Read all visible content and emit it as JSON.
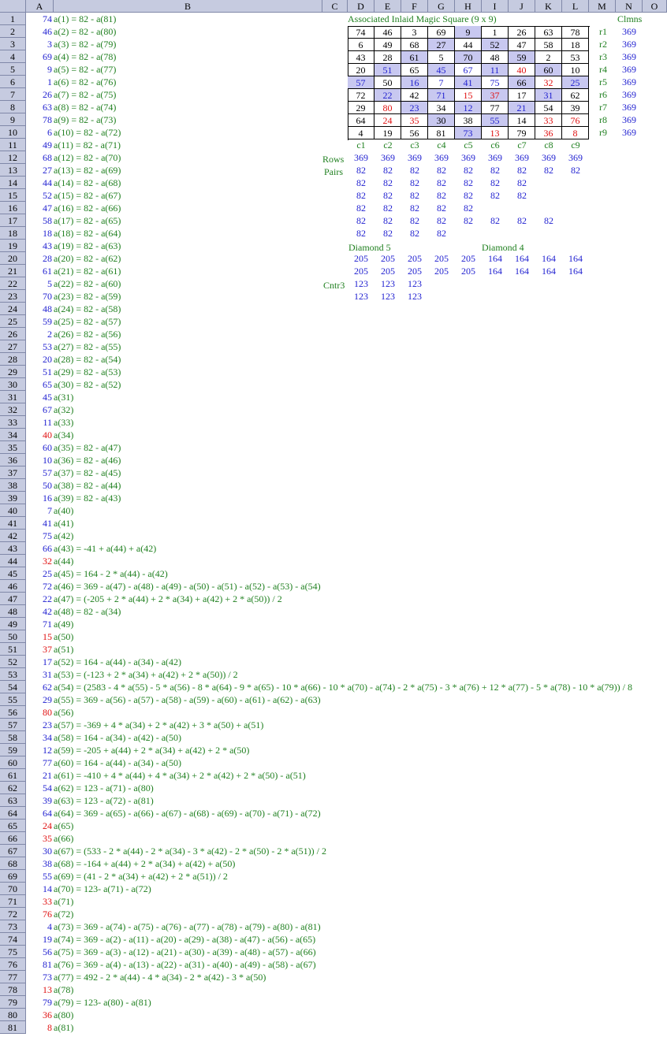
{
  "columns": [
    "A",
    "B",
    "C",
    "D",
    "E",
    "F",
    "G",
    "H",
    "I",
    "J",
    "K",
    "L",
    "M",
    "N",
    "O"
  ],
  "rows_count": 81,
  "colors": {
    "blue": "#1f1fd0",
    "red": "#e01010",
    "green": "#208020",
    "header": "#c6cbe0",
    "highlight": "#c8c8f0"
  },
  "colA": [
    {
      "v": "74",
      "c": "blue"
    },
    {
      "v": "46",
      "c": "blue"
    },
    {
      "v": "3",
      "c": "blue"
    },
    {
      "v": "69",
      "c": "blue"
    },
    {
      "v": "9",
      "c": "blue"
    },
    {
      "v": "1",
      "c": "blue"
    },
    {
      "v": "26",
      "c": "blue"
    },
    {
      "v": "63",
      "c": "blue"
    },
    {
      "v": "78",
      "c": "blue"
    },
    {
      "v": "6",
      "c": "blue"
    },
    {
      "v": "49",
      "c": "blue"
    },
    {
      "v": "68",
      "c": "blue"
    },
    {
      "v": "27",
      "c": "blue"
    },
    {
      "v": "44",
      "c": "blue"
    },
    {
      "v": "52",
      "c": "blue"
    },
    {
      "v": "47",
      "c": "blue"
    },
    {
      "v": "58",
      "c": "blue"
    },
    {
      "v": "18",
      "c": "blue"
    },
    {
      "v": "43",
      "c": "blue"
    },
    {
      "v": "28",
      "c": "blue"
    },
    {
      "v": "61",
      "c": "blue"
    },
    {
      "v": "5",
      "c": "blue"
    },
    {
      "v": "70",
      "c": "blue"
    },
    {
      "v": "48",
      "c": "blue"
    },
    {
      "v": "59",
      "c": "blue"
    },
    {
      "v": "2",
      "c": "blue"
    },
    {
      "v": "53",
      "c": "blue"
    },
    {
      "v": "20",
      "c": "blue"
    },
    {
      "v": "51",
      "c": "blue"
    },
    {
      "v": "65",
      "c": "blue"
    },
    {
      "v": "45",
      "c": "blue"
    },
    {
      "v": "67",
      "c": "blue"
    },
    {
      "v": "11",
      "c": "blue"
    },
    {
      "v": "40",
      "c": "red"
    },
    {
      "v": "60",
      "c": "blue"
    },
    {
      "v": "10",
      "c": "blue"
    },
    {
      "v": "57",
      "c": "blue"
    },
    {
      "v": "50",
      "c": "blue"
    },
    {
      "v": "16",
      "c": "blue"
    },
    {
      "v": "7",
      "c": "blue"
    },
    {
      "v": "41",
      "c": "blue"
    },
    {
      "v": "75",
      "c": "blue"
    },
    {
      "v": "66",
      "c": "blue"
    },
    {
      "v": "32",
      "c": "red"
    },
    {
      "v": "25",
      "c": "blue"
    },
    {
      "v": "72",
      "c": "blue"
    },
    {
      "v": "22",
      "c": "blue"
    },
    {
      "v": "42",
      "c": "blue"
    },
    {
      "v": "71",
      "c": "blue"
    },
    {
      "v": "15",
      "c": "red"
    },
    {
      "v": "37",
      "c": "red"
    },
    {
      "v": "17",
      "c": "blue"
    },
    {
      "v": "31",
      "c": "blue"
    },
    {
      "v": "62",
      "c": "blue"
    },
    {
      "v": "29",
      "c": "blue"
    },
    {
      "v": "80",
      "c": "red"
    },
    {
      "v": "23",
      "c": "blue"
    },
    {
      "v": "34",
      "c": "blue"
    },
    {
      "v": "12",
      "c": "blue"
    },
    {
      "v": "77",
      "c": "blue"
    },
    {
      "v": "21",
      "c": "blue"
    },
    {
      "v": "54",
      "c": "blue"
    },
    {
      "v": "39",
      "c": "blue"
    },
    {
      "v": "64",
      "c": "blue"
    },
    {
      "v": "24",
      "c": "red"
    },
    {
      "v": "35",
      "c": "red"
    },
    {
      "v": "30",
      "c": "blue"
    },
    {
      "v": "38",
      "c": "blue"
    },
    {
      "v": "55",
      "c": "blue"
    },
    {
      "v": "14",
      "c": "blue"
    },
    {
      "v": "33",
      "c": "red"
    },
    {
      "v": "76",
      "c": "red"
    },
    {
      "v": "4",
      "c": "blue"
    },
    {
      "v": "19",
      "c": "blue"
    },
    {
      "v": "56",
      "c": "blue"
    },
    {
      "v": "81",
      "c": "blue"
    },
    {
      "v": "73",
      "c": "blue"
    },
    {
      "v": "13",
      "c": "red"
    },
    {
      "v": "79",
      "c": "blue"
    },
    {
      "v": "36",
      "c": "red"
    },
    {
      "v": "8",
      "c": "red"
    }
  ],
  "colB": [
    "a(1) = 82 - a(81)",
    "a(2) = 82 - a(80)",
    "a(3) = 82 - a(79)",
    "a(4) = 82 - a(78)",
    "a(5) = 82 - a(77)",
    "a(6) = 82 - a(76)",
    "a(7) = 82 - a(75)",
    "a(8) = 82 - a(74)",
    "a(9) = 82 - a(73)",
    "a(10) = 82 - a(72)",
    "a(11) = 82 - a(71)",
    "a(12) = 82 - a(70)",
    "a(13) = 82 - a(69)",
    "a(14) = 82 - a(68)",
    "a(15) = 82 - a(67)",
    "a(16) = 82 - a(66)",
    "a(17) = 82 - a(65)",
    "a(18) = 82 - a(64)",
    "a(19) = 82 - a(63)",
    "a(20) = 82 - a(62)",
    "a(21) = 82 - a(61)",
    "a(22) = 82 - a(60)",
    "a(23) = 82 - a(59)",
    "a(24) = 82 - a(58)",
    "a(25) = 82 - a(57)",
    "a(26) = 82 - a(56)",
    "a(27) = 82 - a(55)",
    "a(28) = 82 - a(54)",
    "a(29) = 82 - a(53)",
    "a(30) = 82 - a(52)",
    "a(31)",
    "a(32)",
    "a(33)",
    "a(34)",
    "a(35) = 82 - a(47)",
    "a(36) = 82 - a(46)",
    "a(37) = 82 - a(45)",
    "a(38) = 82 - a(44)",
    "a(39) = 82 - a(43)",
    "a(40)",
    "a(41)",
    "a(42)",
    "a(43) = -41 + a(44) + a(42)",
    "a(44)",
    "a(45) = 164 - 2 * a(44) - a(42)",
    "a(46) = 369 - a(47) - a(48) - a(49) - a(50) - a(51) - a(52) - a(53) - a(54)",
    "a(47) = (-205 + 2 * a(44) + 2 * a(34) + a(42) + 2 * a(50)) / 2",
    "a(48) = 82 - a(34)",
    "a(49)",
    "a(50)",
    "a(51)",
    "a(52) = 164 - a(44) - a(34) - a(42)",
    "a(53) = (-123 + 2 * a(34) + a(42) + 2 * a(50)) / 2",
    "a(54) = (2583 - 4 * a(55) - 5 * a(56) - 8 * a(64) - 9 * a(65) - 10 * a(66) - 10 * a(70) - a(74) - 2 * a(75) - 3 * a(76) + 12 * a(77) - 5 * a(78) - 10 * a(79)) / 8",
    "a(55) = 369 - a(56) - a(57) - a(58) - a(59) - a(60) - a(61) - a(62) - a(63)",
    "a(56)",
    "a(57) = -369 + 4 * a(34) + 2 * a(42) + 3 * a(50) + a(51)",
    "a(58) = 164 - a(34) - a(42) - a(50)",
    "a(59) = -205 + a(44) + 2 * a(34) + a(42) + 2 * a(50)",
    "a(60) = 164 - a(44) - a(34) - a(50)",
    "a(61) = -410 + 4 * a(44) + 4 * a(34) + 2 * a(42) + 2 * a(50) - a(51)",
    "a(62) = 123 - a(71) - a(80)",
    "a(63) = 123 - a(72) - a(81)",
    "a(64) = 369 - a(65) - a(66) - a(67) - a(68) - a(69) - a(70) - a(71) - a(72)",
    "a(65)",
    "a(66)",
    "a(67) = (533 - 2 * a(44) - 2 * a(34) - 3 * a(42) - 2 * a(50) - 2 * a(51)) / 2",
    "a(68) = -164 + a(44) + 2 * a(34) + a(42) + a(50)",
    "a(69) = (41 - 2 * a(34) + a(42) + 2 * a(51)) / 2",
    "a(70) = 123- a(71) - a(72)",
    "a(71)",
    "a(72)",
    "a(73) = 369 - a(74) - a(75) - a(76) - a(77) - a(78) - a(79) - a(80) - a(81)",
    "a(74) = 369 - a(2) - a(11) - a(20) - a(29) - a(38) - a(47) - a(56) - a(65)",
    "a(75) = 369 - a(3) - a(12) - a(21) - a(30) - a(39) - a(48) - a(57) - a(66)",
    "a(76) = 369 - a(4) - a(13) - a(22) - a(31) - a(40) - a(49) - a(58) - a(67)",
    "a(77) = 492 - 2 * a(44) - 4 * a(34) - 2 * a(42) - 3 * a(50)",
    "a(78)",
    "a(79) = 123- a(80) - a(81)",
    "a(80)",
    "a(81)"
  ],
  "square_title": "Associated Inlaid Magic Square (9 x 9)",
  "square": [
    [
      "74",
      "46",
      "3",
      "69",
      "9",
      "1",
      "26",
      "63",
      "78"
    ],
    [
      "6",
      "49",
      "68",
      "27",
      "44",
      "52",
      "47",
      "58",
      "18"
    ],
    [
      "43",
      "28",
      "61",
      "5",
      "70",
      "48",
      "59",
      "2",
      "53"
    ],
    [
      "20",
      "51",
      "65",
      "45",
      "67",
      "11",
      "40",
      "60",
      "10"
    ],
    [
      "57",
      "50",
      "16",
      "7",
      "41",
      "75",
      "66",
      "32",
      "25"
    ],
    [
      "72",
      "22",
      "42",
      "71",
      "15",
      "37",
      "17",
      "31",
      "62"
    ],
    [
      "29",
      "80",
      "23",
      "34",
      "12",
      "77",
      "21",
      "54",
      "39"
    ],
    [
      "64",
      "24",
      "35",
      "30",
      "38",
      "55",
      "14",
      "33",
      "76"
    ],
    [
      "4",
      "19",
      "56",
      "81",
      "73",
      "13",
      "79",
      "36",
      "8"
    ]
  ],
  "square_fill": [
    [
      0,
      0,
      0,
      0,
      1,
      0,
      0,
      0,
      0
    ],
    [
      0,
      0,
      0,
      1,
      0,
      1,
      0,
      0,
      0
    ],
    [
      0,
      0,
      1,
      0,
      1,
      0,
      1,
      0,
      0
    ],
    [
      0,
      1,
      0,
      1,
      0,
      1,
      0,
      1,
      0
    ],
    [
      1,
      0,
      1,
      0,
      1,
      0,
      1,
      0,
      1
    ],
    [
      0,
      1,
      0,
      1,
      0,
      1,
      0,
      1,
      0
    ],
    [
      0,
      0,
      1,
      0,
      1,
      0,
      1,
      0,
      0
    ],
    [
      0,
      0,
      0,
      1,
      0,
      1,
      0,
      0,
      0
    ],
    [
      0,
      0,
      0,
      0,
      1,
      0,
      0,
      0,
      0
    ]
  ],
  "square_color": [
    [
      "k",
      "k",
      "k",
      "k",
      "k",
      "k",
      "k",
      "k",
      "k"
    ],
    [
      "k",
      "k",
      "k",
      "k",
      "k",
      "k",
      "k",
      "k",
      "k"
    ],
    [
      "k",
      "k",
      "k",
      "k",
      "k",
      "k",
      "k",
      "k",
      "k"
    ],
    [
      "k",
      "b",
      "k",
      "b",
      "b",
      "b",
      "r",
      "k",
      "k"
    ],
    [
      "b",
      "k",
      "b",
      "b",
      "b",
      "b",
      "k",
      "r",
      "b"
    ],
    [
      "k",
      "b",
      "k",
      "b",
      "r",
      "r",
      "k",
      "b",
      "k"
    ],
    [
      "k",
      "r",
      "b",
      "k",
      "b",
      "k",
      "b",
      "k",
      "k"
    ],
    [
      "k",
      "r",
      "r",
      "k",
      "k",
      "b",
      "k",
      "r",
      "r"
    ],
    [
      "k",
      "k",
      "k",
      "k",
      "b",
      "r",
      "k",
      "r",
      "r"
    ]
  ],
  "row_labels": [
    "r1",
    "r2",
    "r3",
    "r4",
    "r5",
    "r6",
    "r7",
    "r8",
    "r9"
  ],
  "row_sums": [
    "369",
    "369",
    "369",
    "369",
    "369",
    "369",
    "369",
    "369",
    "369"
  ],
  "clmns_label": "Clmns",
  "col_labels": [
    "c1",
    "c2",
    "c3",
    "c4",
    "c5",
    "c6",
    "c7",
    "c8",
    "c9"
  ],
  "rows_label": "Rows",
  "rows_values": [
    "369",
    "369",
    "369",
    "369",
    "369",
    "369",
    "369",
    "369",
    "369"
  ],
  "pairs_label": "Pairs",
  "pairs": [
    [
      "82",
      "82",
      "82",
      "82",
      "82",
      "82",
      "82",
      "82",
      "82"
    ],
    [
      "82",
      "82",
      "82",
      "82",
      "82",
      "82",
      "82"
    ],
    [
      "82",
      "82",
      "82",
      "82",
      "82",
      "82",
      "82"
    ],
    [
      "82",
      "82",
      "82",
      "82",
      "82"
    ],
    [
      "82",
      "82",
      "82",
      "82",
      "82",
      "82",
      "82",
      "82"
    ],
    [
      "82",
      "82",
      "82",
      "82"
    ]
  ],
  "diamond5_label": "Diamond 5",
  "diamond4_label": "Diamond 4",
  "diamond5": [
    [
      "205",
      "205",
      "205",
      "205",
      "205"
    ],
    [
      "205",
      "205",
      "205",
      "205",
      "205"
    ]
  ],
  "diamond4": [
    [
      "164",
      "164",
      "164",
      "164"
    ],
    [
      "164",
      "164",
      "164",
      "164"
    ]
  ],
  "cntr3_label": "Cntr3",
  "cntr3": [
    [
      "123",
      "123",
      "123"
    ],
    [
      "123",
      "123",
      "123"
    ]
  ]
}
